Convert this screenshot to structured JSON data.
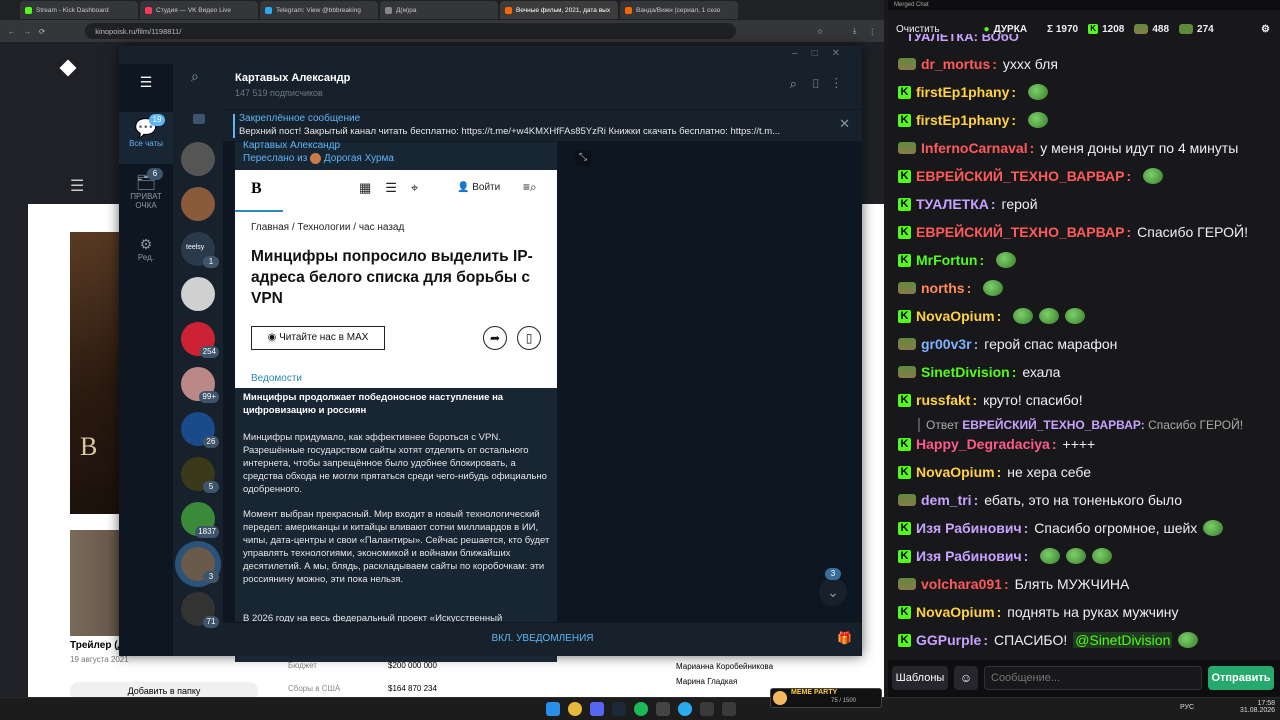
{
  "browser": {
    "tabs": [
      {
        "label": "Stream - Kick Dashboard",
        "color": "#53fc18"
      },
      {
        "label": "Студия — VK Видео Live",
        "color": "#ff3b5c"
      },
      {
        "label": "Telegram: View @bbbreaking",
        "color": "#2aabee"
      },
      {
        "label": "Д(м)ра",
        "color": "#888888"
      },
      {
        "label": "Вечные фильм, 2021, дата вых",
        "color": "#ff6600",
        "active": true
      },
      {
        "label": "Ванда/Вижн (сериал, 1 сезо",
        "color": "#ff6600"
      }
    ],
    "url": "kinopoisk.ru/film/1198811/"
  },
  "site": {
    "trailer_label": "Трейлер (д",
    "trailer_date": "19 августа 2021",
    "poster_letters": "B E",
    "add_button": "Добавить в папку",
    "rows": [
      {
        "label": "Бюджет",
        "value": "$200 000 000"
      },
      {
        "label": "Сборы в США",
        "value": "$164 870 234"
      }
    ],
    "cast": [
      "Марианна Коробейникова",
      "Марина Гладкая"
    ]
  },
  "telegram": {
    "folders": [
      {
        "label": "Все чаты",
        "badge": "19"
      },
      {
        "label": "ПРИВАТ ОЧКА",
        "badge": "6"
      },
      {
        "label": "Ред.",
        "badge": ""
      }
    ],
    "chat_badges": [
      "1",
      "254",
      "99+",
      "26",
      "5",
      "1837",
      "3",
      "71"
    ],
    "teelsy": "teelsy",
    "channel_name": "Картавых Александр",
    "subscribers": "147 519 подписчиков",
    "pinned_title": "Закреплённое сообщение",
    "pinned_text": "Верхний пост! Закрытый канал читать бесплатно: https://t.me/+w4KMXHfFAs85YzRi Книжки скачать бесплатно:  https://t.m...",
    "author": "Картавых Александр",
    "forwarded_prefix": "Переслано из",
    "forwarded_from": "Дорогая Хурма",
    "embed": {
      "logo": "B",
      "login": "Войти",
      "breadcrumb": "Главная  /  Технологии  /  час назад",
      "headline": "Минцифры попросило выделить IP-адреса белого списка для борьбы с VPN",
      "max_button": "Читайте нас в MAX",
      "source": "Ведомости"
    },
    "post_title": "Минцифры продолжает победоносное наступление на цифровизацию и россиян",
    "paragraphs": [
      "Минцифры придумало, как эффективнее бороться с VPN. Разрешённые государством сайты хотят отделить от остального интернета, чтобы запрещённое было удобнее блокировать, а средства обхода не могли прятаться среди чего-нибудь официально одобренного.",
      "Момент выбран прекрасный. Мир входит в новый технологический передел: американцы и китайцы вливают сотни миллиардов в ИИ, чипы, дата-центры и свои «Палантиры». Сейчас решается, кто будет управлять технологиями, экономикой и войнами ближайших десятилетий. А мы, блядь, раскладываем сайты по коробочкам: эти россиянину можно, эти пока нельзя.",
      "В 2026 году на весь федеральный проект «Искусственный"
    ],
    "scroll_badge": "3",
    "notifications": "ВКЛ. УВЕДОМЛЕНИЯ"
  },
  "chat": {
    "window_title": "Merged Chat",
    "clear": "Очистить",
    "stats": {
      "channel": "ДУРКА",
      "sigma": "Σ 1970",
      "kick": "1208",
      "tw": "488",
      "vk": "274"
    },
    "top_partial": "ТУАЛЕТКА: ВОбО",
    "messages": [
      {
        "src": "t",
        "user": "dr_mortus",
        "color": "#ff5a5a",
        "text": "уххх бля"
      },
      {
        "src": "k",
        "user": "firstEp1phany",
        "color": "#ffd23f",
        "text": "",
        "emotes": 1
      },
      {
        "src": "k",
        "user": "firstEp1phany",
        "color": "#ffd23f",
        "text": "",
        "emotes": 1
      },
      {
        "src": "t",
        "user": "InfernoCarnaval",
        "color": "#ff5a5a",
        "text": "у меня доны идут по 4 минуты"
      },
      {
        "src": "k",
        "user": "ЕВРЕЙСКИЙ_ТЕХНО_ВАРВАР",
        "color": "#ff5a5a",
        "text": "",
        "emotes": 1
      },
      {
        "src": "k",
        "user": "ТУАЛЕТКА",
        "color": "#c8a2ff",
        "text": "герой"
      },
      {
        "src": "k",
        "user": "ЕВРЕЙСКИЙ_ТЕХНО_ВАРВАР",
        "color": "#ff5a5a",
        "text": "Спасибо ГЕРОЙ!"
      },
      {
        "src": "k",
        "user": "MrFortun",
        "color": "#53fc18",
        "text": "",
        "emotes": 1
      },
      {
        "src": "t",
        "user": "norths",
        "color": "#ff8a5a",
        "text": "",
        "emotes": 1
      },
      {
        "src": "k",
        "user": "NovaOpium",
        "color": "#ffd23f",
        "text": "",
        "emotes": 3
      },
      {
        "src": "t",
        "user": "gr00v3r",
        "color": "#7fb3ff",
        "text": "герой спас марафон"
      },
      {
        "src": "t",
        "user": "SinetDivision",
        "color": "#53fc18",
        "text": "ехала"
      },
      {
        "src": "k",
        "user": "russfakt",
        "color": "#ffd23f",
        "text": "круто! спасибо!"
      },
      {
        "src": "k",
        "user": "Happy_Degradaciya",
        "color": "#ff5a8a",
        "text": "++++"
      },
      {
        "src": "k",
        "user": "NovaOpium",
        "color": "#ffd23f",
        "text": "не хера себе"
      },
      {
        "src": "t",
        "user": "dem_tri",
        "color": "#c8a2ff",
        "text": "ебать, это на тоненького было"
      },
      {
        "src": "k",
        "user": "Изя Рабинович",
        "color": "#c8a2ff",
        "text": "Спасибо огромное, шейх",
        "emotes": 1
      },
      {
        "src": "k",
        "user": "Изя Рабинович",
        "color": "#c8a2ff",
        "text": "",
        "emotes": 3
      },
      {
        "src": "t",
        "user": "volchara091",
        "color": "#ff5a5a",
        "text": "Блять МУЖЧИНА"
      },
      {
        "src": "k",
        "user": "NovaOpium",
        "color": "#ffd23f",
        "text": "поднять на руках мужчину"
      },
      {
        "src": "k",
        "user": "GGPurple",
        "color": "#c8a2ff",
        "text": "СПАСИБО!",
        "mention": "@SinetDivision",
        "emotes": 1
      }
    ],
    "reply": {
      "prefix": "Ответ",
      "user": "ЕВРЕЙСКИЙ_ТЕХНО_ВАРВАР",
      "text": "Спасибо ГЕРОЙ!"
    },
    "templates": "Шаблоны",
    "placeholder": "Сообщение...",
    "send": "Отправить"
  },
  "taskbar": {
    "meme": "MEME PARTY",
    "meme_count": "75 / 1500",
    "lang": "РУС",
    "time": "17:58",
    "date": "31.08.2026"
  }
}
